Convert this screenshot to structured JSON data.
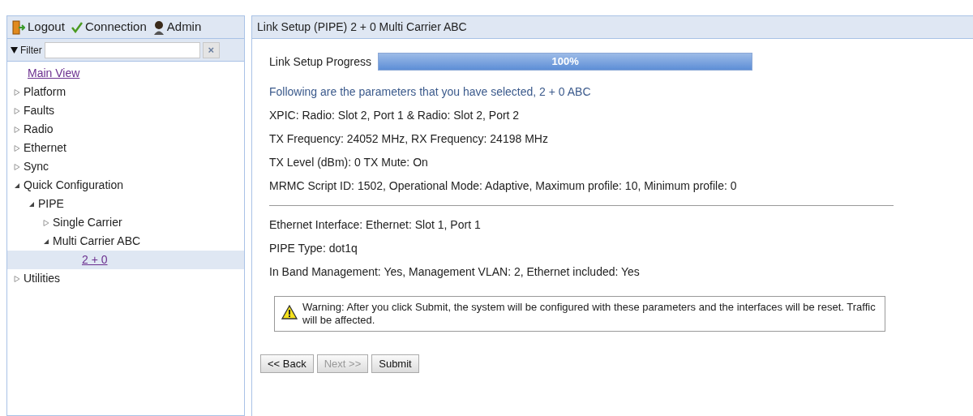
{
  "toolbar": [
    {
      "kind": "logout",
      "label": "Logout"
    },
    {
      "kind": "connection",
      "label": "Connection"
    },
    {
      "kind": "admin",
      "label": "Admin"
    }
  ],
  "filter": {
    "label": "Filter",
    "clear": "×"
  },
  "tree": [
    {
      "label": "Main View",
      "kind": "link",
      "selected": false
    },
    {
      "label": "Platform",
      "expanded": false,
      "selected": false
    },
    {
      "label": "Faults",
      "expanded": false,
      "selected": false
    },
    {
      "label": "Radio",
      "expanded": false,
      "selected": false
    },
    {
      "label": "Ethernet",
      "expanded": false,
      "selected": false
    },
    {
      "label": "Sync",
      "expanded": false,
      "selected": false
    },
    {
      "label": "Quick Configuration",
      "expanded": true,
      "selected": false,
      "children": [
        {
          "label": "PIPE",
          "expanded": true,
          "selected": false,
          "children": [
            {
              "label": "Single Carrier",
              "expanded": false,
              "selected": false
            },
            {
              "label": "Multi Carrier ABC",
              "expanded": true,
              "selected": false,
              "children": [
                {
                  "label": "2 + 0",
                  "kind": "link",
                  "selected": true
                }
              ]
            }
          ]
        }
      ]
    },
    {
      "label": "Utilities",
      "expanded": false,
      "selected": false
    }
  ],
  "panel": {
    "title": "Link Setup (PIPE) 2 + 0 Multi Carrier ABC",
    "progress": {
      "label": "Link Setup Progress",
      "level": 1,
      "reading": "100%"
    },
    "params": [
      {
        "kind": "intro",
        "text": "Following are the parameters that you have selected, 2 + 0 ABC"
      },
      {
        "kind": "line",
        "text": "XPIC: Radio: Slot 2, Port 1 & Radio: Slot 2, Port 2"
      },
      {
        "kind": "line",
        "text": "TX Frequency: 24052 MHz, RX Frequency: 24198 MHz"
      },
      {
        "kind": "line",
        "text": "TX Level (dBm): 0 TX Mute: On"
      },
      {
        "kind": "line",
        "text": "MRMC Script ID: 1502, Operational Mode: Adaptive, Maximum profile: 10, Minimum profile: 0"
      },
      {
        "kind": "divider"
      },
      {
        "kind": "line",
        "text": "Ethernet Interface: Ethernet: Slot 1, Port 1"
      },
      {
        "kind": "line",
        "text": "PIPE Type: dot1q"
      },
      {
        "kind": "line",
        "text": "In Band Management: Yes, Management VLAN: 2, Ethernet included: Yes"
      }
    ],
    "warning": "Warning: After you click Submit, the system will be configured with these parameters and the interfaces will be reset. Traffic will be affected.",
    "buttons": [
      {
        "label": "<< Back",
        "disabled": false
      },
      {
        "label": "Next >>",
        "disabled": true
      },
      {
        "label": "Submit",
        "disabled": false
      }
    ]
  }
}
